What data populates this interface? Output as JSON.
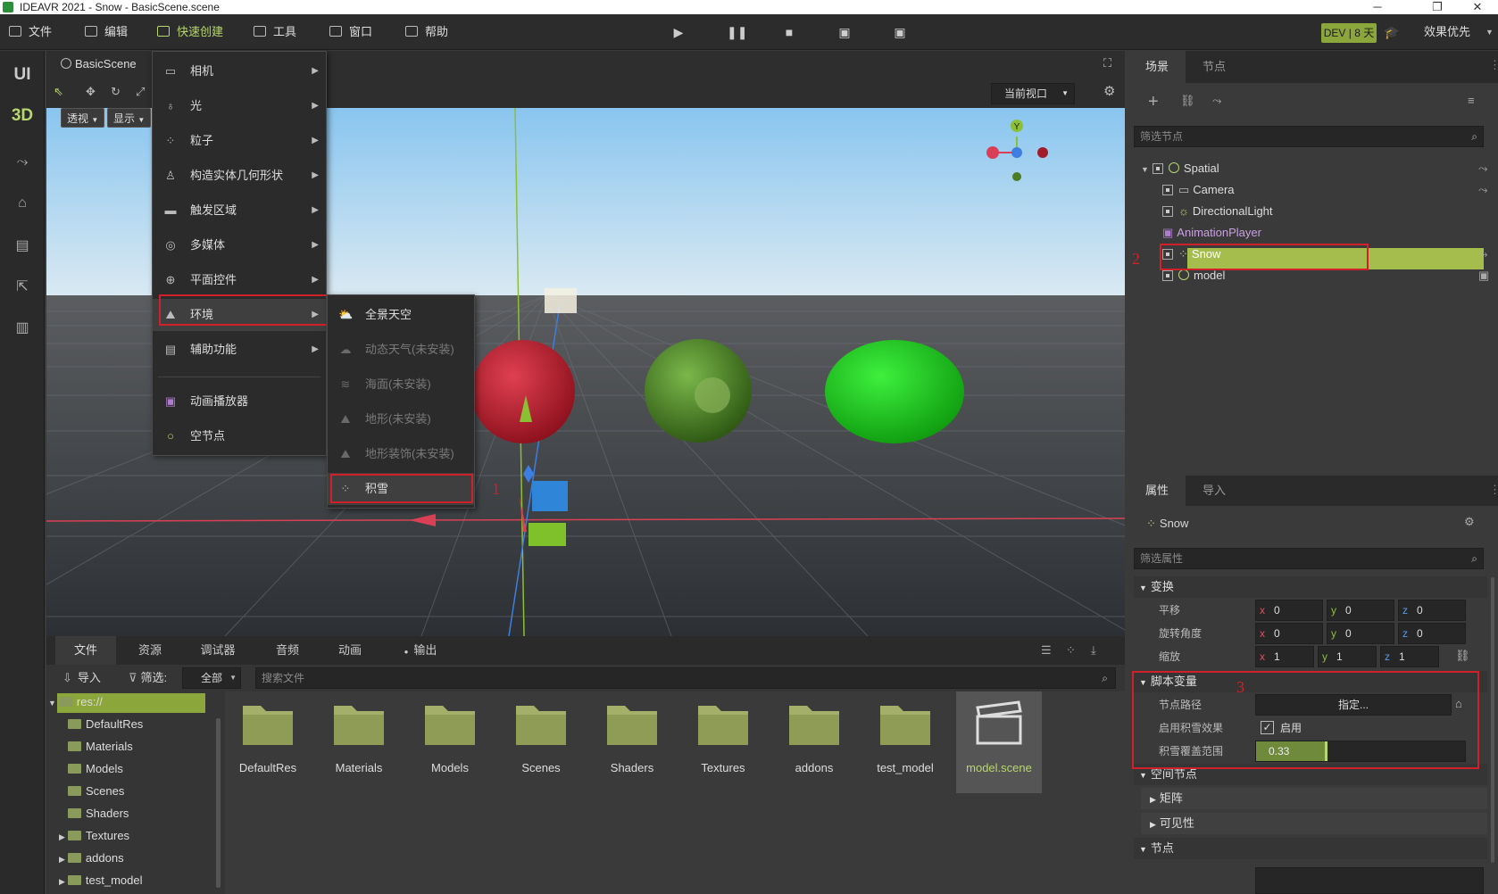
{
  "window": {
    "title": "IDEAVR 2021 - Snow - BasicScene.scene"
  },
  "menubar": {
    "items": [
      {
        "label": "文件"
      },
      {
        "label": "编辑"
      },
      {
        "label": "快速创建"
      },
      {
        "label": "工具"
      },
      {
        "label": "窗口"
      },
      {
        "label": "帮助"
      }
    ],
    "dev_badge": "DEV | 8 天",
    "quality": "效果优先"
  },
  "leftdock": {
    "ui": "UI",
    "3d": "3D"
  },
  "viewport": {
    "tab": "BasicScene",
    "perspective": "透视",
    "display": "显示",
    "current_view": "当前视口",
    "gizmo_y": "Y"
  },
  "create_menu": {
    "items": [
      {
        "label": "相机",
        "icon": "camera-icon",
        "arrow": true
      },
      {
        "label": "光",
        "icon": "bulb-icon",
        "arrow": true
      },
      {
        "label": "粒子",
        "icon": "particles-icon",
        "arrow": true
      },
      {
        "label": "构造实体几何形状",
        "icon": "csg-icon",
        "arrow": true
      },
      {
        "label": "触发区域",
        "icon": "trigger-icon",
        "arrow": true
      },
      {
        "label": "多媒体",
        "icon": "media-icon",
        "arrow": true
      },
      {
        "label": "平面控件",
        "icon": "control-icon",
        "arrow": true
      },
      {
        "label": "环境",
        "icon": "environment-icon",
        "arrow": true
      },
      {
        "label": "辅助功能",
        "icon": "helper-icon",
        "arrow": true
      },
      {
        "label": "动画播放器",
        "icon": "animation-icon",
        "arrow": false
      },
      {
        "label": "空节点",
        "icon": "empty-node-icon",
        "arrow": false
      }
    ]
  },
  "env_submenu": {
    "items": [
      {
        "label": "全景天空",
        "disabled": false
      },
      {
        "label": "动态天气(未安装)",
        "disabled": true
      },
      {
        "label": "海面(未安装)",
        "disabled": true
      },
      {
        "label": "地形(未安装)",
        "disabled": true
      },
      {
        "label": "地形装饰(未安装)",
        "disabled": true
      },
      {
        "label": "积雪",
        "disabled": false
      }
    ]
  },
  "annotations": {
    "n1": "1",
    "n2": "2",
    "n3": "3"
  },
  "scene_panel": {
    "tabs": [
      "场景",
      "节点"
    ],
    "filter_placeholder": "筛选节点",
    "nodes": [
      {
        "label": "Spatial"
      },
      {
        "label": "Camera"
      },
      {
        "label": "DirectionalLight"
      },
      {
        "label": "AnimationPlayer"
      },
      {
        "label": "Snow"
      },
      {
        "label": "model"
      }
    ]
  },
  "prop_panel": {
    "tabs": [
      "属性",
      "导入"
    ],
    "node_name": "Snow",
    "filter_placeholder": "筛选属性",
    "transform": {
      "section": "变换",
      "translate": "平移",
      "rotate": "旋转角度",
      "scale": "缩放",
      "t": [
        "0",
        "0",
        "0"
      ],
      "r": [
        "0",
        "0",
        "0"
      ],
      "s": [
        "1",
        "1",
        "1"
      ],
      "x": "x",
      "y": "y",
      "z": "z"
    },
    "script_vars": {
      "section": "脚本变量",
      "node_path": "节点路径",
      "node_path_value": "指定...",
      "enable_snow": "启用积雪效果",
      "enable_label": "启用",
      "coverage": "积雪覆盖范围",
      "coverage_value": "0.33",
      "coverage_fraction": 0.33
    },
    "spatial_section": "空间节点",
    "matrix": "矩阵",
    "visibility": "可见性",
    "node_section": "节点"
  },
  "bottom": {
    "tabs": [
      "文件",
      "资源",
      "调试器",
      "音频",
      "动画",
      "输出"
    ],
    "import": "导入",
    "filter": "筛选:",
    "filter_value": "全部",
    "search_placeholder": "搜索文件",
    "tree": [
      "res://",
      "DefaultRes",
      "Materials",
      "Models",
      "Scenes",
      "Shaders",
      "Textures",
      "addons",
      "test_model"
    ],
    "files": [
      "DefaultRes",
      "Materials",
      "Models",
      "Scenes",
      "Shaders",
      "Textures",
      "addons",
      "test_model",
      "model.scene"
    ]
  },
  "colors": {
    "accent": "#b7d66e",
    "highlight": "#a4bd4c",
    "annot": "#d0202a"
  }
}
